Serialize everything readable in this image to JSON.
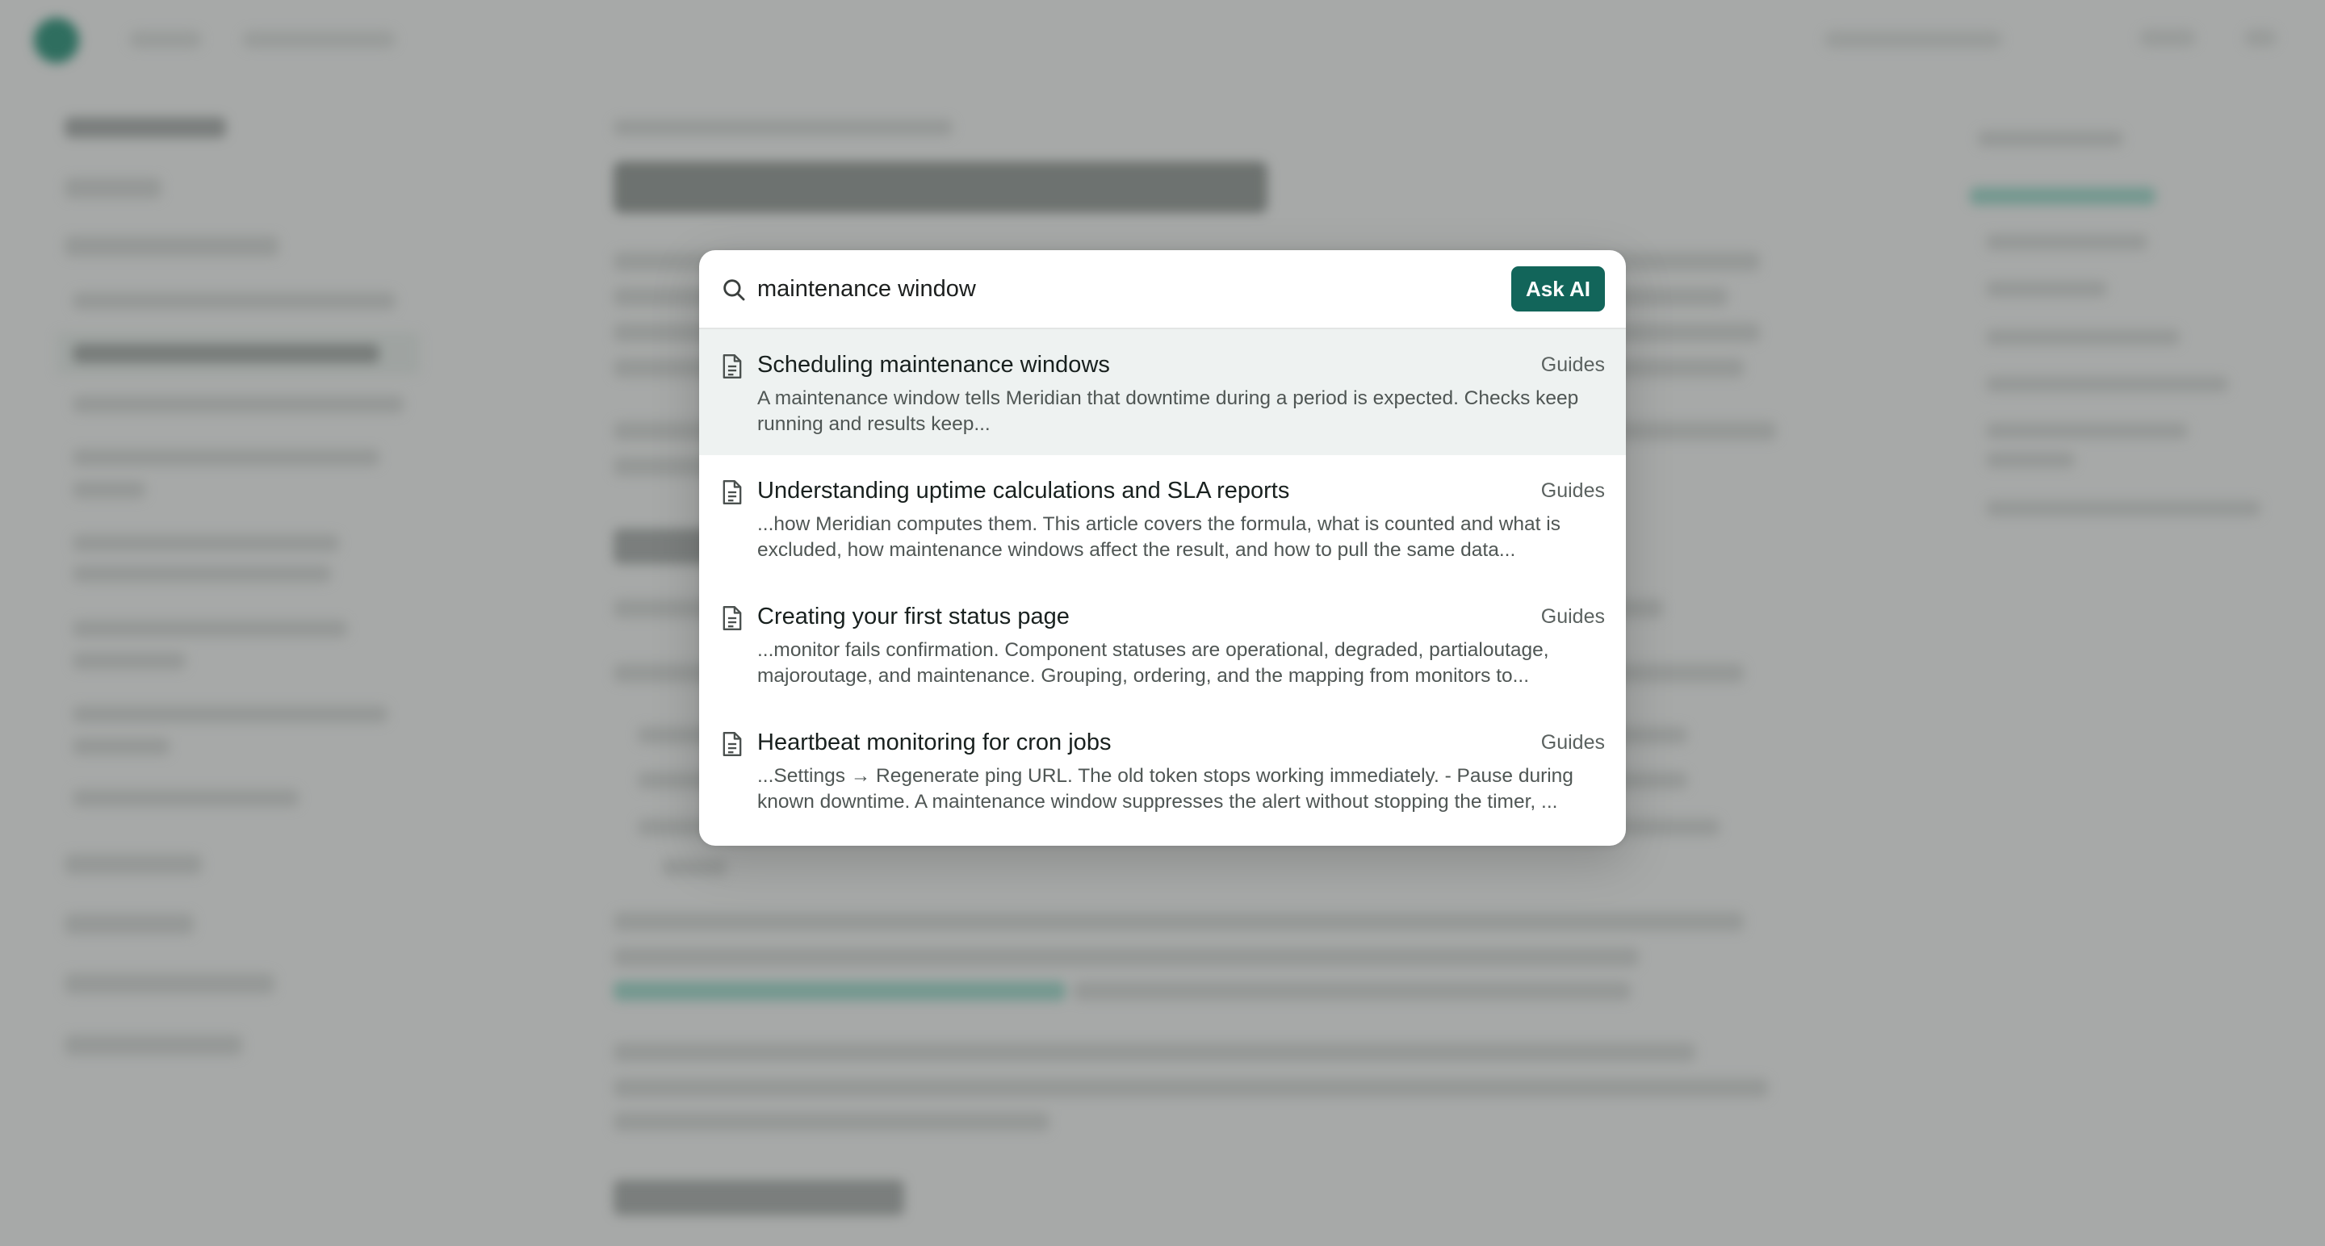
{
  "search": {
    "query": "maintenance window",
    "ask_ai_label": "Ask AI"
  },
  "icons": {
    "search": "search-icon",
    "result": "document-icon"
  },
  "colors": {
    "accent": "#12655a",
    "active_row": "#eef2f1"
  },
  "results": [
    {
      "title": "Scheduling maintenance windows",
      "category": "Guides",
      "snippet": "A maintenance window tells Meridian that downtime during a period is expected. Checks keep running and results keep..."
    },
    {
      "title": "Understanding uptime calculations and SLA reports",
      "category": "Guides",
      "snippet": "...how Meridian computes them. This article covers the formula, what is counted and what is excluded, how maintenance windows affect the result, and how to pull the same data..."
    },
    {
      "title": "Creating your first status page",
      "category": "Guides",
      "snippet": "...monitor fails confirmation. Component statuses are operational, degraded, partialoutage, majoroutage, and maintenance. Grouping, ordering, and the mapping from monitors to..."
    },
    {
      "title": "Heartbeat monitoring for cron jobs",
      "category": "Guides",
      "snippet": "...Settings → Regenerate ping URL. The old token stops working immediately. - Pause during known downtime. A maintenance window suppresses the alert without stopping the timer, ..."
    }
  ]
}
